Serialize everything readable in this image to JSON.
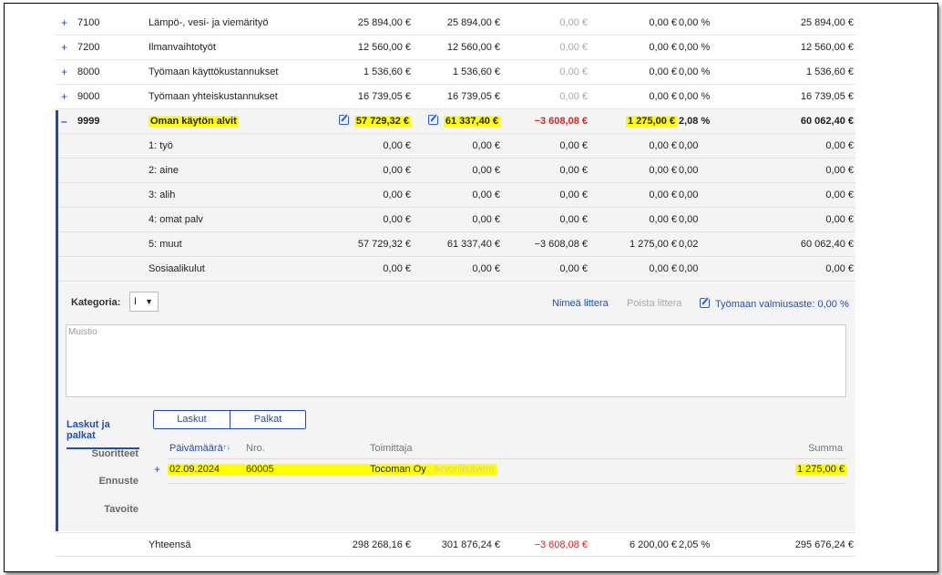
{
  "rows": [
    {
      "code": "7100",
      "name": "Lämpö-, vesi- ja viemärityö",
      "v1": "25 894,00 €",
      "v2": "25 894,00 €",
      "v3": "0,00 €",
      "v4": "0,00 €",
      "v5": "0,00 %",
      "v6": "25 894,00 €"
    },
    {
      "code": "7200",
      "name": "Ilmanvaihtotyöt",
      "v1": "12 560,00 €",
      "v2": "12 560,00 €",
      "v3": "0,00 €",
      "v4": "0,00 €",
      "v5": "0,00 %",
      "v6": "12 560,00 €"
    },
    {
      "code": "8000",
      "name": "Työmaan käyttökustannukset",
      "v1": "1 536,60 €",
      "v2": "1 536,60 €",
      "v3": "0,00 €",
      "v4": "0,00 €",
      "v5": "0,00 %",
      "v6": "1 536,60 €"
    },
    {
      "code": "9000",
      "name": "Työmaan yhteiskustannukset",
      "v1": "16 739,05 €",
      "v2": "16 739,05 €",
      "v3": "0,00 €",
      "v4": "0,00 €",
      "v5": "0,00 %",
      "v6": "16 739,05 €"
    }
  ],
  "expand_plus": "+",
  "expand_minus": "–",
  "expanded": {
    "code": "9999",
    "name": "Oman käytön alvit",
    "v1": "57 729,32 €",
    "v2": "61 337,40 €",
    "v3": "−3 608,08 €",
    "v4": "1 275,00 €",
    "v5": "2,08 %",
    "v6": "60 062,40 €"
  },
  "subrows": [
    {
      "name": "1: työ",
      "v1": "0,00 €",
      "v2": "0,00 €",
      "v3": "0,00 €",
      "v4": "0,00 €",
      "v5": "0,00",
      "v6": "0,00 €"
    },
    {
      "name": "2: aine",
      "v1": "0,00 €",
      "v2": "0,00 €",
      "v3": "0,00 €",
      "v4": "0,00 €",
      "v5": "0,00",
      "v6": "0,00 €"
    },
    {
      "name": "3: alih",
      "v1": "0,00 €",
      "v2": "0,00 €",
      "v3": "0,00 €",
      "v4": "0,00 €",
      "v5": "0,00",
      "v6": "0,00 €"
    },
    {
      "name": "4: omat palv",
      "v1": "0,00 €",
      "v2": "0,00 €",
      "v3": "0,00 €",
      "v4": "0,00 €",
      "v5": "0,00",
      "v6": "0,00 €"
    },
    {
      "name": "5: muut",
      "v1": "57 729,32 €",
      "v2": "61 337,40 €",
      "v3": "−3 608,08 €",
      "v4": "1 275,00 €",
      "v5": "0,02",
      "v6": "60 062,40 €"
    },
    {
      "name": "Sosiaalikulut",
      "v1": "0,00 €",
      "v2": "0,00 €",
      "v3": "0,00 €",
      "v4": "0,00 €",
      "v5": "0,00",
      "v6": "0,00 €"
    }
  ],
  "panel": {
    "category_label": "Kategoria:",
    "category_value": "I",
    "category_arrow": "▼",
    "rename_link": "Nimeä littera",
    "remove_link": "Poista littera",
    "progress_link": "Työmaan valmiusaste: 0,00 %",
    "memo_placeholder": "Muistio",
    "side_tab_active": "Laskut ja palkat",
    "side_items": [
      "Suoritteet",
      "Ennuste",
      "Tavoite"
    ],
    "toggle": [
      "Laskut",
      "Palkat"
    ],
    "invoice_headers": {
      "date": "Päivämäärä",
      "sort_mark": "↑↓",
      "nro": "Nro.",
      "supplier": "Toimittaja",
      "sum": "Summa"
    },
    "invoice": {
      "expand": "+",
      "date": "02.09.2024",
      "nro": "60005",
      "supplier": "Tocoman Oy",
      "tag": "Arvonlisävero",
      "sum": "1 275,00 €"
    }
  },
  "total": {
    "name": "Yhteensä",
    "v1": "298 268,16 €",
    "v2": "301 876,24 €",
    "v3": "−3 608,08 €",
    "v4": "6 200,00 €",
    "v5": "2,05 %",
    "v6": "295 676,24 €"
  },
  "colors": {
    "accent": "#1f4fb5",
    "highlight": "#ffff00",
    "negative": "#dd2222"
  }
}
